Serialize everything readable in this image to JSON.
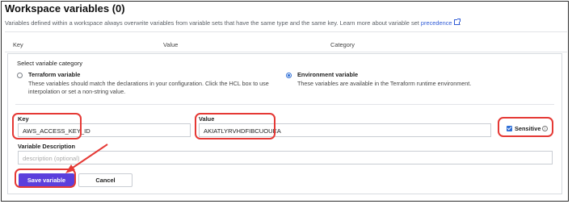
{
  "header": {
    "title": "Workspace variables (0)",
    "intro_text": "Variables defined within a workspace always overwrite variables from variable sets that have the same type and the same key. Learn more about variable set",
    "intro_link": "precedence",
    "intro_suffix": "."
  },
  "columns": {
    "key": "Key",
    "value": "Value",
    "category": "Category"
  },
  "category": {
    "label": "Select variable category",
    "options": [
      {
        "title": "Terraform variable",
        "description_line1": "These variables should match the declarations in your configuration. Click the HCL box to use",
        "description_line2": "interpolation or set a non-string value.",
        "selected": false
      },
      {
        "title": "Environment variable",
        "description_line1": "These variables are available in the Terraform runtime environment.",
        "selected": true
      }
    ]
  },
  "fields": {
    "key_label": "Key",
    "key_value": "AWS_ACCESS_KEY_ID",
    "value_label": "Value",
    "value_value": "AKIATLYRVHDFIBCUOUEA",
    "sensitive_label": "Sensitive",
    "sensitive_checked": true,
    "description_label": "Variable Description",
    "description_placeholder": "description (optional)"
  },
  "buttons": {
    "save": "Save variable",
    "cancel": "Cancel"
  },
  "colors": {
    "primary": "#5b3fdc",
    "highlight": "#e53935",
    "link": "#2f5bd6",
    "checkbox": "#2f6fd6"
  }
}
